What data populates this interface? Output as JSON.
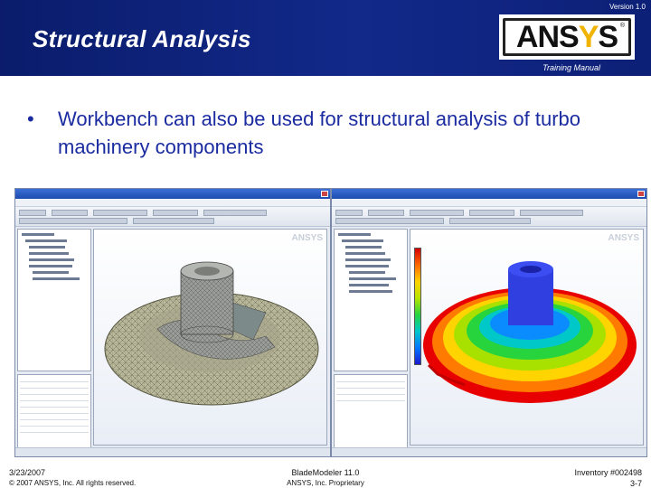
{
  "header": {
    "version": "Version 1.0",
    "title": "Structural Analysis",
    "training_manual": "Training Manual",
    "logo_text_a": "ANS",
    "logo_text_y": "Y",
    "logo_text_s": "S",
    "colors": {
      "band": "#12298a",
      "logo_accent": "#f0b400"
    }
  },
  "bullet": {
    "marker": "•",
    "text": "Workbench can also be used for structural analysis of turbo machinery components"
  },
  "screenshots": {
    "left": {
      "watermark": "ANSYS",
      "icon": "meshed-impeller-image"
    },
    "right": {
      "watermark": "ANSYS",
      "icon": "stress-contour-impeller-image"
    }
  },
  "footer": {
    "date": "3/23/2007",
    "copyright": "© 2007 ANSYS, Inc. All rights reserved.",
    "center_line1": "BladeModeler 11.0",
    "center_line2": "ANSYS, Inc. Proprietary",
    "inventory": "Inventory #002498",
    "page": "3-7"
  }
}
